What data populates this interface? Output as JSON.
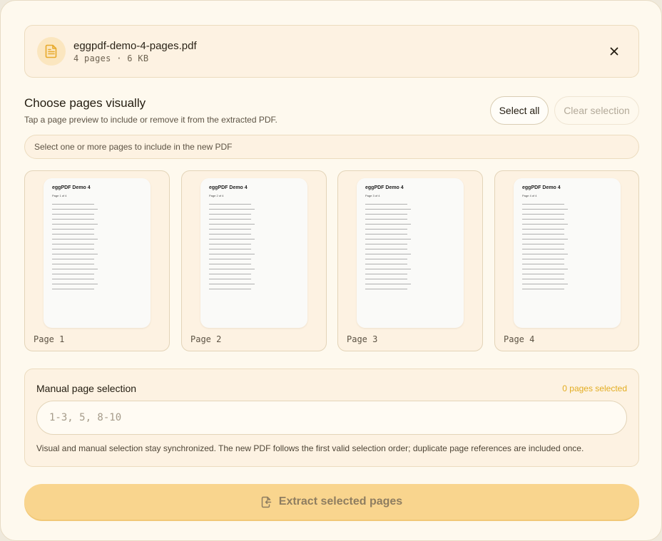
{
  "file": {
    "name": "eggpdf-demo-4-pages.pdf",
    "meta": "4 pages · 6 KB"
  },
  "choose": {
    "title": "Choose pages visually",
    "subtitle": "Tap a page preview to include or remove it from the extracted PDF.",
    "select_all": "Select all",
    "clear_selection": "Clear selection",
    "hint": "Select one or more pages to include in the new PDF"
  },
  "pages": [
    {
      "label": "Page 1",
      "preview_title": "eggPDF Demo 4",
      "preview_sub": "Page 1 of 4"
    },
    {
      "label": "Page 2",
      "preview_title": "eggPDF Demo 4",
      "preview_sub": "Page 2 of 4"
    },
    {
      "label": "Page 3",
      "preview_title": "eggPDF Demo 4",
      "preview_sub": "Page 3 of 4"
    },
    {
      "label": "Page 4",
      "preview_title": "eggPDF Demo 4",
      "preview_sub": "Page 4 of 4"
    }
  ],
  "manual": {
    "title": "Manual page selection",
    "count": "0 pages selected",
    "placeholder": "1-3, 5, 8-10",
    "value": "",
    "note": "Visual and manual selection stay synchronized. The new PDF follows the first valid selection order; duplicate page references are included once."
  },
  "extract": {
    "label": "Extract selected pages"
  },
  "colors": {
    "accent": "#f9d58e",
    "count_text": "#e3ad22",
    "file_icon": "#e7a92a"
  },
  "icons": {
    "file": "document-icon",
    "close": "close-icon",
    "extract": "file-export-icon"
  }
}
